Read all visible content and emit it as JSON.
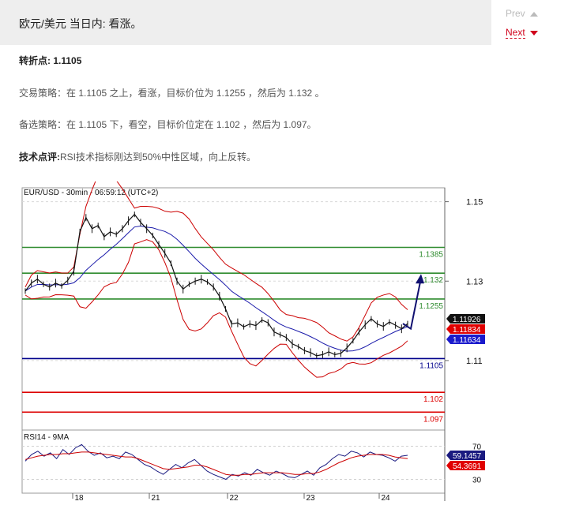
{
  "header": {
    "title": "欧元/美元 当日内: 看涨。",
    "prev_label": "Prev",
    "next_label": "Next"
  },
  "content": {
    "pivot_label": "转折点:",
    "pivot_value": "1.1105",
    "strategy_label": "交易策略：",
    "strategy_text": "在 1.1105 之上，看涨，目标价位为 1.1255 ，然后为 1.132 。",
    "alt_label": "备选策略：",
    "alt_text": "在 1.1105 下，看空，目标价位定在 1.102 ，然后为 1.097。",
    "comment_label": "技术点评:",
    "comment_text": "RSI技术指标刚达到50%中性区域，向上反转。"
  },
  "chart_data": [
    {
      "type": "line",
      "title": "EUR/USD - 30min - 06:59:12 (UTC+2)",
      "x_labels": [
        "18",
        "21",
        "22",
        "23",
        "24"
      ],
      "y_ticks": [
        "1.15",
        "1.13",
        "1.11"
      ],
      "ylim": [
        1.0925,
        1.1535
      ],
      "levels": [
        {
          "value": 1.1385,
          "label": "1.1385",
          "color": "#2e8b2e"
        },
        {
          "value": 1.132,
          "label": "1.132",
          "color": "#2e8b2e"
        },
        {
          "value": 1.1255,
          "label": "1.1255",
          "color": "#2e8b2e"
        },
        {
          "value": 1.1105,
          "label": "1.1105",
          "color": "#00008b"
        },
        {
          "value": 1.102,
          "label": "1.102",
          "color": "#dd0000"
        },
        {
          "value": 1.097,
          "label": "1.097",
          "color": "#dd0000"
        }
      ],
      "price_tags": [
        {
          "value": 1.11926,
          "label": "1.11926",
          "bg": "#111111"
        },
        {
          "value": 1.11834,
          "label": "1.11834",
          "bg": "#e00000"
        },
        {
          "value": 1.11634,
          "label": "1.11634",
          "bg": "#1a1acc"
        }
      ],
      "price_series": [
        1.1275,
        1.1295,
        1.1305,
        1.1292,
        1.1285,
        1.1295,
        1.1288,
        1.1302,
        1.1325,
        1.1425,
        1.146,
        1.1432,
        1.144,
        1.1412,
        1.1424,
        1.1418,
        1.1432,
        1.1452,
        1.1468,
        1.1448,
        1.1432,
        1.1415,
        1.1392,
        1.137,
        1.1345,
        1.13,
        1.128,
        1.1292,
        1.13,
        1.1305,
        1.1298,
        1.1285,
        1.1262,
        1.123,
        1.1192,
        1.1195,
        1.1185,
        1.1192,
        1.1188,
        1.1202,
        1.1195,
        1.1172,
        1.1165,
        1.1158,
        1.1142,
        1.1135,
        1.1125,
        1.112,
        1.1112,
        1.1115,
        1.1122,
        1.1115,
        1.1118,
        1.1132,
        1.115,
        1.1172,
        1.119,
        1.1205,
        1.1192,
        1.1186,
        1.1197,
        1.1189,
        1.118,
        1.1193
      ],
      "forecast": [
        1.118,
        1.131
      ],
      "rsi_series": {
        "title": "RSI14 - 9MA",
        "y_ticks": [
          "70",
          "30"
        ],
        "ylim": [
          20,
          80
        ],
        "tags": [
          {
            "value": 59.1457,
            "label": "59.1457",
            "bg": "#1a1a80"
          },
          {
            "value": 54.3691,
            "label": "54.3691",
            "bg": "#e00000"
          }
        ],
        "rsi": [
          52,
          60,
          64,
          58,
          62,
          55,
          66,
          60,
          68,
          72,
          64,
          59,
          62,
          56,
          58,
          55,
          63,
          60,
          54,
          48,
          45,
          40,
          36,
          42,
          48,
          44,
          50,
          54,
          47,
          40,
          36,
          33,
          30,
          36,
          34,
          38,
          35,
          42,
          38,
          35,
          40,
          37,
          33,
          32,
          36,
          40,
          35,
          44,
          48,
          55,
          60,
          58,
          64,
          62,
          57,
          63,
          60,
          59,
          56,
          52,
          58,
          59
        ],
        "ma": [
          54,
          56,
          58,
          59,
          60,
          60,
          61,
          61,
          62,
          63,
          63,
          62,
          61,
          60,
          59,
          58,
          57,
          57,
          55,
          52,
          49,
          46,
          43,
          42,
          43,
          44,
          45,
          47,
          47,
          45,
          42,
          39,
          36,
          35,
          35,
          36,
          36,
          37,
          38,
          38,
          38,
          38,
          37,
          36,
          36,
          37,
          37,
          39,
          42,
          46,
          50,
          53,
          56,
          58,
          59,
          60,
          60,
          60,
          59,
          57,
          56,
          55
        ]
      }
    }
  ]
}
